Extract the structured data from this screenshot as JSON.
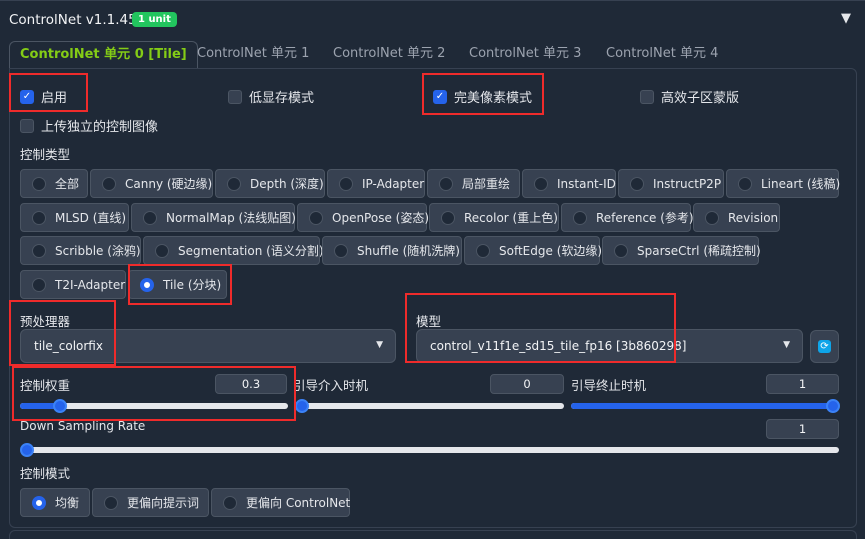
{
  "header": {
    "title": "ControlNet v1.1.455",
    "badge": "1 unit",
    "collapse_glyph": "▼"
  },
  "tabs": [
    {
      "label": "ControlNet 单元 0 [Tile]",
      "active": true
    },
    {
      "label": "ControlNet 单元 1",
      "active": false
    },
    {
      "label": "ControlNet 单元 2",
      "active": false
    },
    {
      "label": "ControlNet 单元 3",
      "active": false
    },
    {
      "label": "ControlNet 单元 4",
      "active": false
    }
  ],
  "checkboxes": {
    "enable": {
      "label": "启用",
      "checked": true
    },
    "lowvram": {
      "label": "低显存模式",
      "checked": false
    },
    "pixel_perfect": {
      "label": "完美像素模式",
      "checked": true
    },
    "effective_region": {
      "label": "高效子区蒙版",
      "checked": false
    },
    "upload_independent": {
      "label": "上传独立的控制图像",
      "checked": false
    }
  },
  "control_type": {
    "label": "控制类型",
    "selected": "Tile (分块)",
    "options": [
      "全部",
      "Canny (硬边缘)",
      "Depth (深度)",
      "IP-Adapter",
      "局部重绘",
      "Instant-ID",
      "InstructP2P",
      "Lineart (线稿)",
      "MLSD (直线)",
      "NormalMap (法线贴图)",
      "OpenPose (姿态)",
      "Recolor (重上色)",
      "Reference (参考)",
      "Revision",
      "Scribble (涂鸦)",
      "Segmentation (语义分割)",
      "Shuffle (随机洗牌)",
      "SoftEdge (软边缘)",
      "SparseCtrl (稀疏控制)",
      "T2I-Adapter",
      "Tile (分块)"
    ]
  },
  "preprocessor": {
    "label": "预处理器",
    "value": "tile_colorfix"
  },
  "model": {
    "label": "模型",
    "value": "control_v11f1e_sd15_tile_fp16 [3b860298]"
  },
  "sliders": {
    "weight": {
      "label": "控制权重",
      "value": "0.3",
      "min": 0,
      "max": 2,
      "pos": 0.15
    },
    "start": {
      "label": "引导介入时机",
      "value": "0",
      "min": 0,
      "max": 1,
      "pos": 0
    },
    "end": {
      "label": "引导终止时机",
      "value": "1",
      "min": 0,
      "max": 1,
      "pos": 1
    },
    "down_sampling": {
      "label": "Down Sampling Rate",
      "value": "1",
      "min": 1,
      "max": 32,
      "pos": 0
    }
  },
  "control_mode": {
    "label": "控制模式",
    "options": [
      "均衡",
      "更偏向提示词",
      "更偏向 ControlNet"
    ],
    "selected": "均衡"
  },
  "colors": {
    "accent": "#2563eb",
    "tab_active": "#84cc16",
    "highlight": "#ef2b2b",
    "badge": "#22c55e"
  }
}
